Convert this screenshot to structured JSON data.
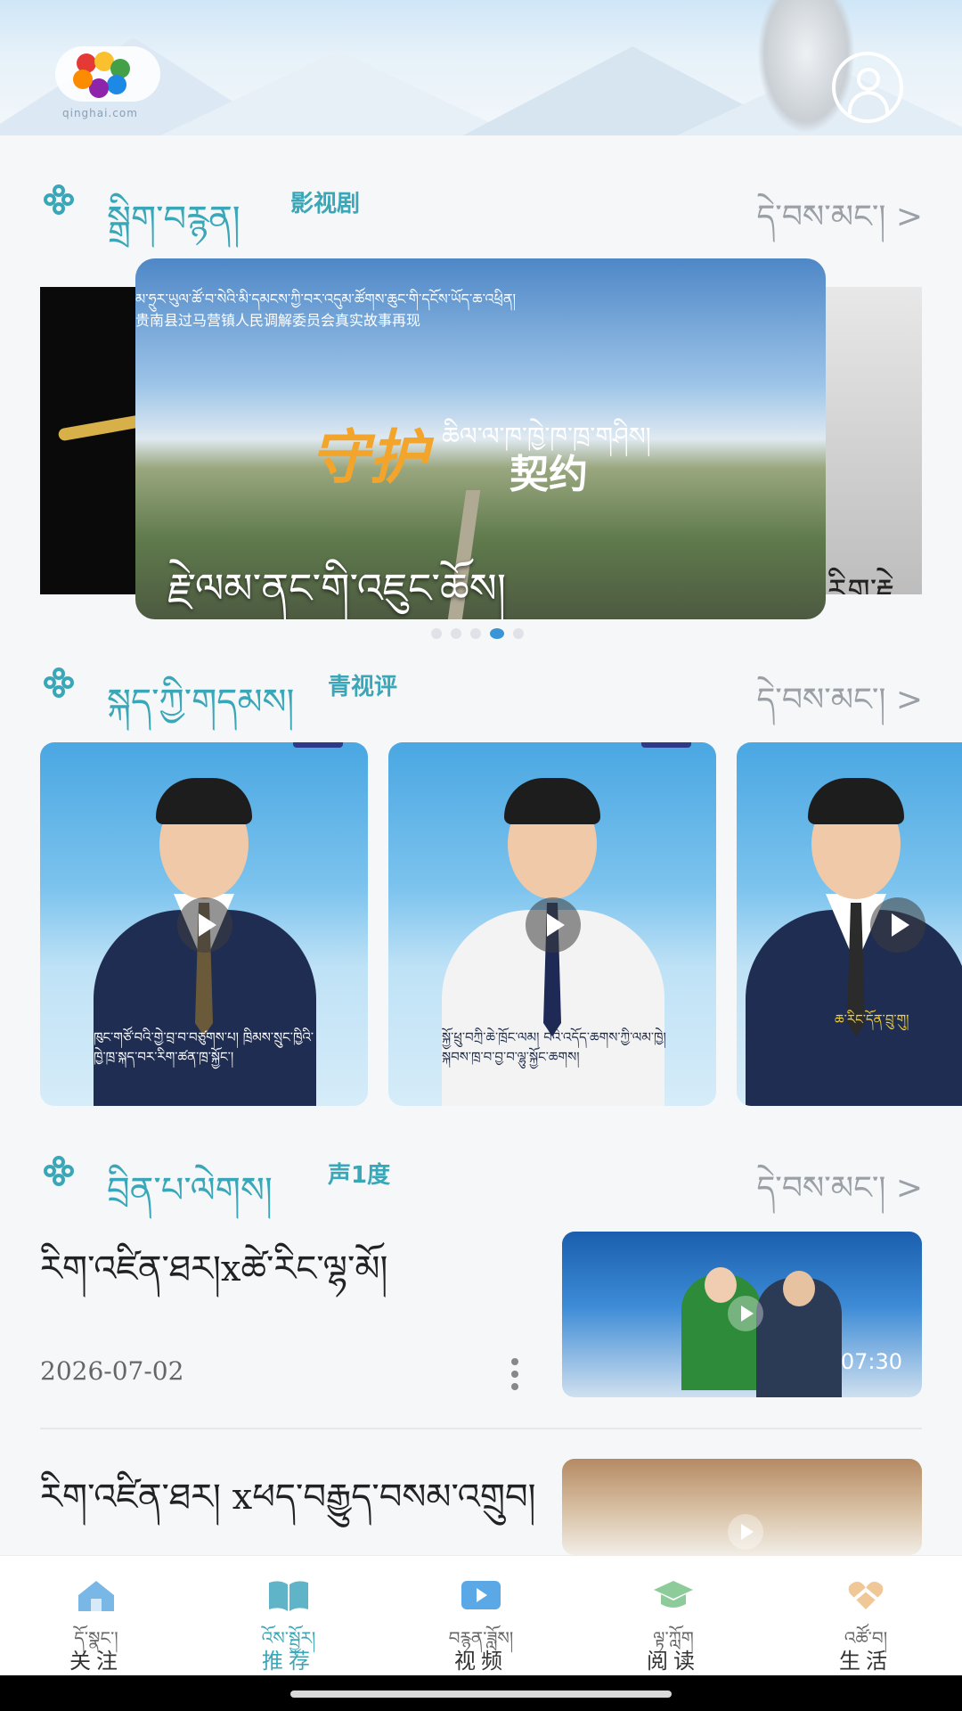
{
  "header": {
    "logo_text": "qinghai.com",
    "avatar_icon": "user-circle-icon"
  },
  "sections": [
    {
      "id": "film",
      "title_tib": "སྒྲིག་བརྙན།",
      "title_cn": "影视剧",
      "more_tib": "དེ་བས་མང་། >"
    },
    {
      "id": "review",
      "title_tib": "སྐད་ཀྱི་གདམས།",
      "title_cn": "青视评",
      "more_tib": "དེ་བས་མང་། >"
    },
    {
      "id": "voice",
      "title_tib": "བྲིན་པ་ལེགས།",
      "title_cn": "声1度",
      "more_tib": "དེ་བས་མང་། >"
    }
  ],
  "carousel": {
    "ribbon_tib": "མ་ཧྲུར་ཡུལ་ཚོ་བ་སེའི་མི་དམངས་ཀྱི་བར་འདུམ་ཚོགས་ཆུང་གི་དངོས་ཡོད་ཆ་འཕྲིན།",
    "ribbon_cn": "贵南县过马营镇人民调解委员会真实故事再现",
    "title_gold": "守护",
    "title_tib": "ཆིལ་ལ་ཁ་ཁྱེ་ཁ་ཁྲ་གཤིས།",
    "title_cn": "契约",
    "caption": "རྗེ་ལམ་ནང་གི་འཇུང་ཆོས།",
    "right_caption": "རིག་རྗེ",
    "dots": 5,
    "active_dot": 4
  },
  "video_cards": [
    {
      "subtitle": "ཁུང་གཙོ་བའི་གྱེ་བྲ་བ་བཙུགས་པ། ཁྲིམས་སྲུང་ཁྱིའི་ཁྱེ་ཁྲ་སྐད་བར་རིག་ཚན་ཁྲ་སྐྱོང་།",
      "play_icon": "play-icon"
    },
    {
      "subtitle": "སྐྱོ་ཕྲུ་བཀྲི་ཆེ་ཁྲོང་ལམ། བའི་འདོད་ཆགས་ཀྱི་ལམ་ཁྱེ། སྐབས་ཁྲ་བ་བྱ་བ་ལྷུ་སྐྱོང་ཆགས།",
      "play_icon": "play-icon"
    },
    {
      "subtitle": "ཆ་རིང་དོན་བྲུ་གུ།",
      "play_icon": "play-icon"
    }
  ],
  "news": [
    {
      "title": "རིག་འཛིན་ཐར།xཚེ་རིང་ལྷ་མོ།",
      "date": "2026-07-02",
      "duration": "07:30"
    },
    {
      "title": "རིག་འཛིན་ཐར། xཕད་བརྒྱུད་བསམ་འགྲུབ།"
    }
  ],
  "bottom_nav": [
    {
      "tib": "དོ་སྣང་།",
      "cn": "关注",
      "icon": "home-icon",
      "color": "#79b7e6"
    },
    {
      "tib": "འོས་སྦྱོར།",
      "cn": "推荐",
      "icon": "book-open-icon",
      "color": "#5fb4c7",
      "active": true
    },
    {
      "tib": "བརྙན་ཟློས།",
      "cn": "视频",
      "icon": "play-screen-icon",
      "color": "#5aa8e6"
    },
    {
      "tib": "ལྟ་ཀློག",
      "cn": "阅读",
      "icon": "graduation-cap-icon",
      "color": "#8dcc9a"
    },
    {
      "tib": "འཚོ་བ།",
      "cn": "生活",
      "icon": "heart-hands-icon",
      "color": "#f0c796"
    }
  ],
  "colors": {
    "accent": "#3aa7b8",
    "active_dot": "#3a95d6"
  }
}
